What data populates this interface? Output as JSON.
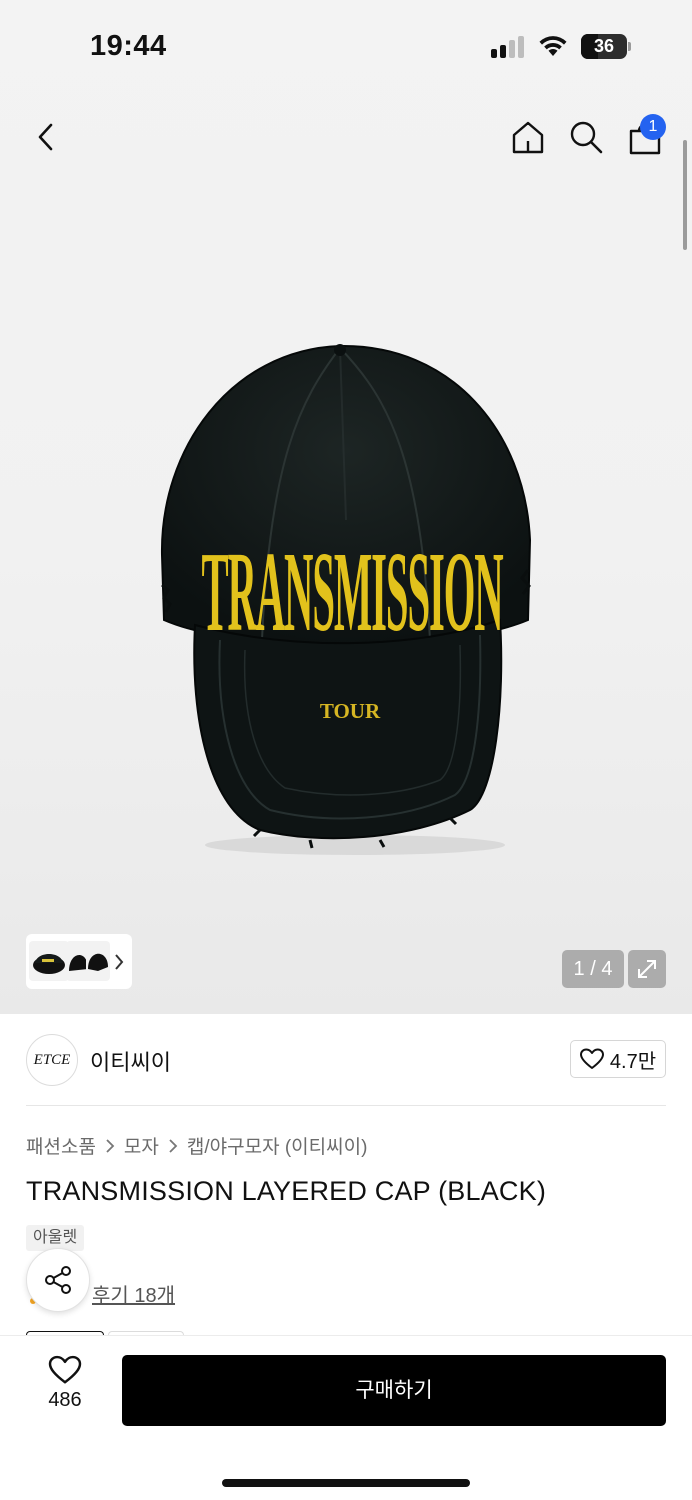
{
  "status_bar": {
    "time": "19:44",
    "battery": "36",
    "battery_fraction": 0.36
  },
  "nav": {
    "icons": [
      "back-icon",
      "home-icon",
      "search-icon",
      "shopping-bag-icon"
    ],
    "cart_badge": "1"
  },
  "gallery": {
    "cap_text": "TRANSMISSION",
    "cap_subtext": "TOUR",
    "counter": "1 / 4",
    "thumbnail_count": 3,
    "colors": {
      "cap": "#101615",
      "embroidery": "#e2c21c"
    }
  },
  "brand": {
    "logo_text": "ETCE",
    "name": "이티씨이",
    "likes": "4.7만"
  },
  "product": {
    "breadcrumb": [
      "패션소품",
      "모자",
      "캡/야구모자 (이티씨이)"
    ],
    "title": "TRANSMISSION LAYERED CAP (BLACK)",
    "tag": "아울렛",
    "reviews": "후기 18개"
  },
  "bottom_bar": {
    "wish_count": "486",
    "buy_label": "구매하기",
    "colors": {
      "buy_button": "#000000",
      "badge": "#2463f0"
    }
  }
}
